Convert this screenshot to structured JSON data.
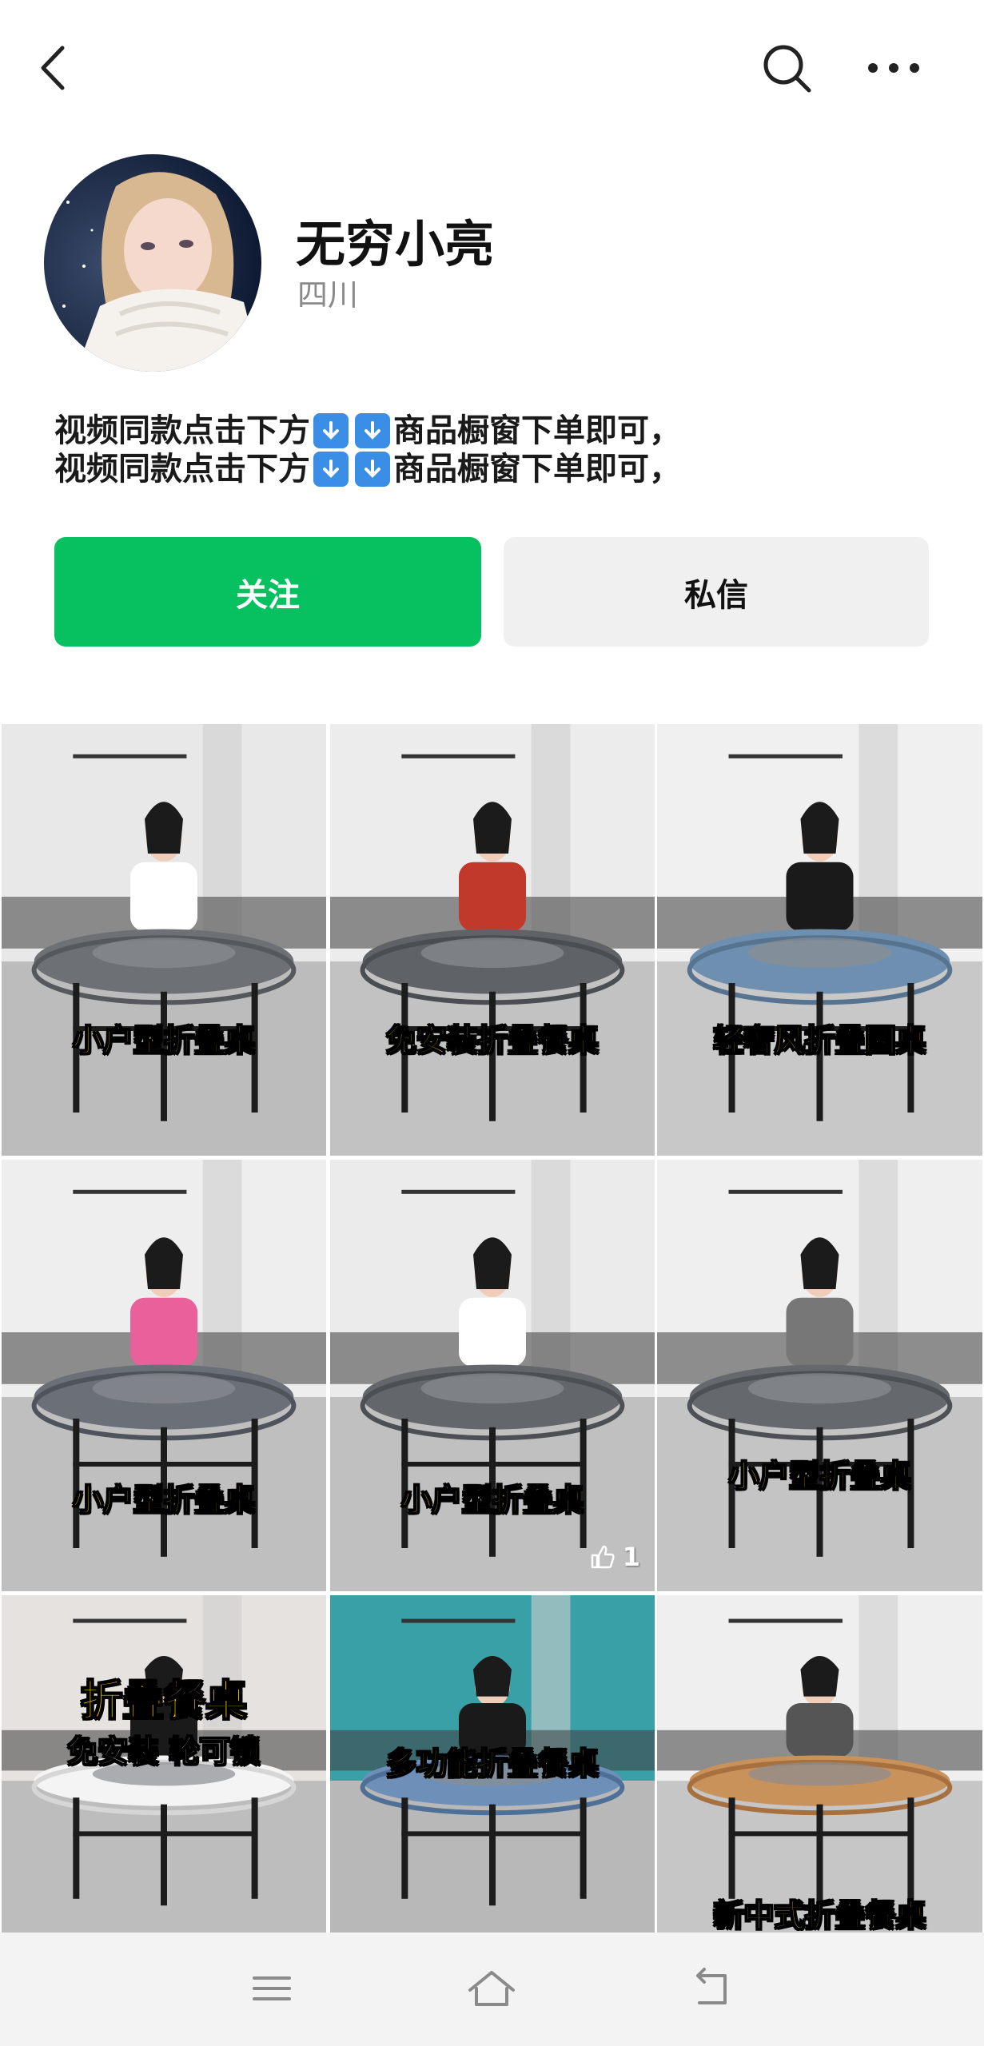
{
  "header": {
    "back_icon": "chevron-left-icon",
    "search_icon": "search-icon",
    "more_icon": "more-horizontal-icon"
  },
  "profile": {
    "name": "无穷小亮",
    "location": "四川",
    "bio_lines": [
      {
        "before": "视频同款点击下方",
        "after": "商品橱窗下单即可，"
      },
      {
        "before": "视频同款点击下方",
        "after": "商品橱窗下单即可，"
      }
    ]
  },
  "actions": {
    "follow_label": "关注",
    "message_label": "私信",
    "follow_color": "#07c160"
  },
  "videos": [
    {
      "caption": "小户型折叠桌",
      "likes": null
    },
    {
      "caption": "免安装折叠餐桌",
      "likes": null
    },
    {
      "caption": "轻奢风折叠圆桌",
      "likes": null
    },
    {
      "caption": "小户型折叠桌",
      "likes": null
    },
    {
      "caption": "小户型折叠桌",
      "likes": "1"
    },
    {
      "caption": "小户型折叠桌",
      "likes": null
    },
    {
      "caption": "折叠餐桌",
      "caption2": "免安装 轮可锁",
      "likes": null
    },
    {
      "caption": "多功能折叠餐桌",
      "likes": null
    },
    {
      "caption": "新中式折叠餐桌",
      "likes": null
    }
  ],
  "system_bar": {
    "menu_icon": "menu-icon",
    "home_icon": "home-icon",
    "back_icon": "back-return-icon"
  }
}
